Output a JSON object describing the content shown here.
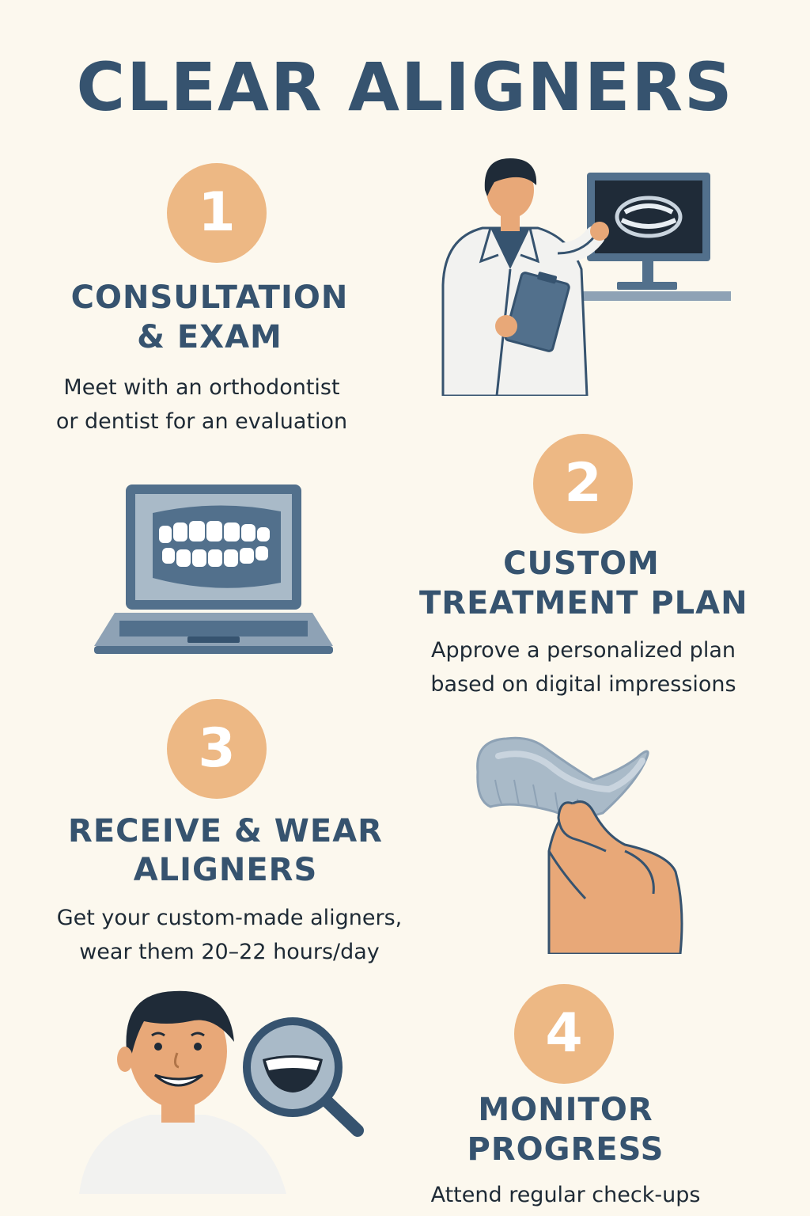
{
  "title": "CLEAR ALIGNERS",
  "colors": {
    "background": "#fcf8ee",
    "heading": "#36536f",
    "badge": "#edb884",
    "text": "#1e2a35",
    "slate": "#5f7a93",
    "skin": "#e8a878"
  },
  "steps": [
    {
      "number": "1",
      "title_line1": "CONSULTATION",
      "title_line2": "& EXAM",
      "desc_line1": "Meet with an orthodontist",
      "desc_line2": "or dentist for an evaluation",
      "illustration": "dentist-with-monitor-icon"
    },
    {
      "number": "2",
      "title_line1": "CUSTOM",
      "title_line2": "TREATMENT PLAN",
      "desc_line1": "Approve a personalized plan",
      "desc_line2": "based on digital impressions",
      "illustration": "laptop-with-teeth-icon"
    },
    {
      "number": "3",
      "title_line1": "RECEIVE & WEAR",
      "title_line2": "ALIGNERS",
      "desc_line1": "Get your custom-made aligners,",
      "desc_line2": "wear them 20–22 hours/day",
      "illustration": "hand-holding-aligner-icon"
    },
    {
      "number": "4",
      "title_line1": "MONITOR",
      "title_line2": "PROGRESS",
      "desc_line1": "Attend regular check-ups",
      "illustration": "smiling-man-magnifier-icon"
    }
  ]
}
